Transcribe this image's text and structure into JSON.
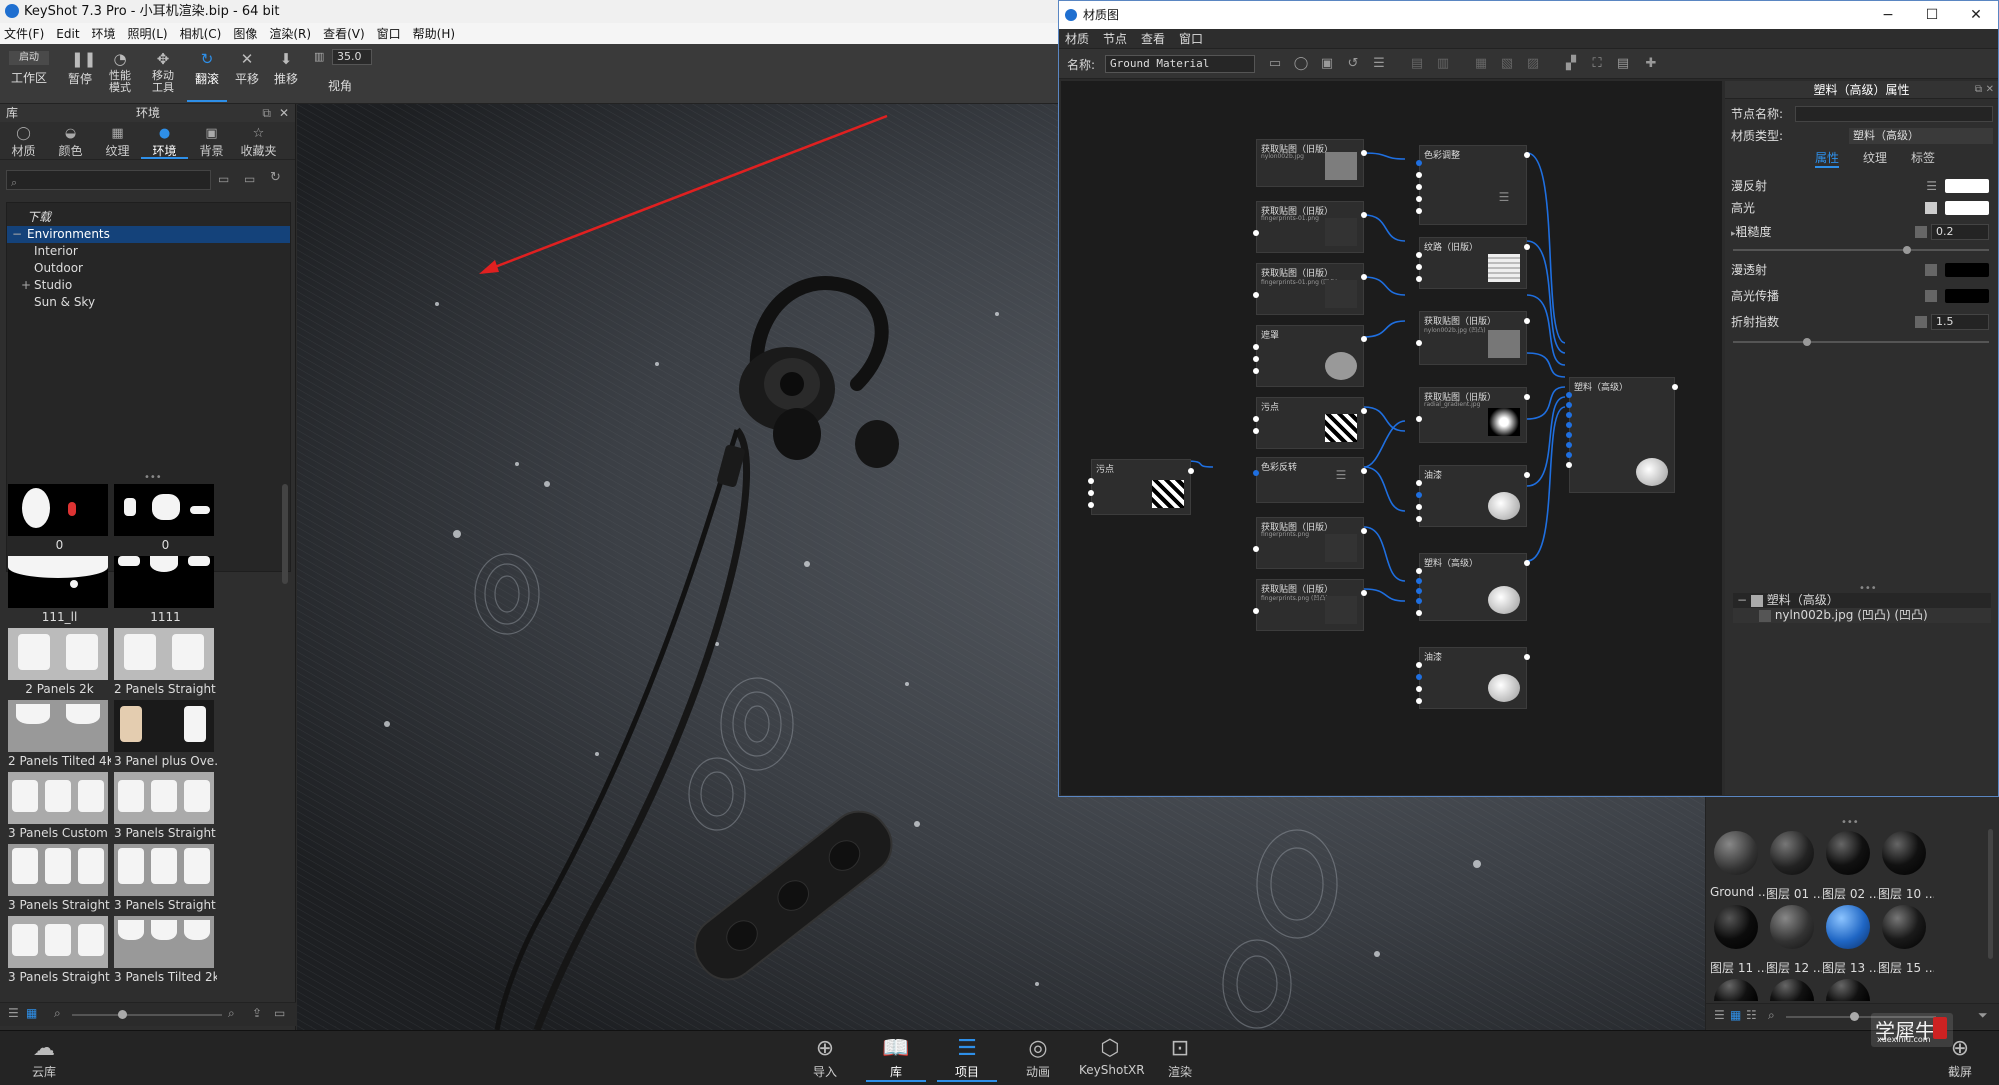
{
  "app": {
    "title": "KeyShot 7.3 Pro - 小耳机渲染.bip - 64 bit",
    "menu": [
      "文件(F)",
      "Edit",
      "环境",
      "照明(L)",
      "相机(C)",
      "图像",
      "渲染(R)",
      "查看(V)",
      "窗口",
      "帮助(H)"
    ]
  },
  "toolbar": {
    "start_label": "启动",
    "workspace_label": "工作区",
    "pause_label": "暂停",
    "perf_label": "性能模式",
    "move_label": "移动工具",
    "tumble_label": "翻滚",
    "pan_label": "平移",
    "dolly_label": "推移",
    "fov_value": "35.0",
    "view_label": "视角"
  },
  "library": {
    "panel_title": "库",
    "section_title": "环境",
    "tabs": [
      "材质",
      "颜色",
      "纹理",
      "环境",
      "背景",
      "收藏夹"
    ],
    "active_tab": "环境",
    "tree": [
      "下载",
      "Environments",
      "Interior",
      "Outdoor",
      "Studio",
      "Sun & Sky"
    ],
    "thumbnails": [
      "0",
      "0",
      "111_ll",
      "1111",
      "2 Panels 2k",
      "2 Panels Straight...",
      "2 Panels Tilted 4K",
      "3 Panel plus Ove...",
      "3 Panels Custom ...",
      "3 Panels Straight...",
      "3 Panels Straight...",
      "3 Panels Straight...",
      "3 Panels Straight...",
      "3 Panels Tilted 2k"
    ]
  },
  "dock": {
    "cloud_label": "云库",
    "items": [
      "导入",
      "库",
      "项目",
      "动画",
      "KeyShotXR",
      "渲染"
    ],
    "screen_label": "截屏"
  },
  "material_graph": {
    "window_title": "材质图",
    "menu": [
      "材质",
      "节点",
      "查看",
      "窗口"
    ],
    "name_label": "名称:",
    "name_value": "Ground Material",
    "nodes": {
      "n1_title": "获取贴图（旧版）",
      "n1_sub": "nylon002b.jpg",
      "n2_title": "获取贴图（旧版）",
      "n2_sub": "fingerprints-01.png",
      "n3_title": "获取贴图（旧版）",
      "n3_sub": "fingerprints-01.png (凹凸)",
      "n4_title": "遮罩",
      "n5_title": "污点",
      "n6_title": "色彩反转",
      "n7_title": "获取贴图（旧版）",
      "n7_sub": "fingerprints.png",
      "n8_title": "获取贴图（旧版）",
      "n8_sub": "fingerprints.png (凹凸)",
      "n9_title": "色彩调整",
      "n10_title": "纹路（旧版）",
      "n11_title": "获取贴图（旧版）",
      "n11_sub": "nylon002b.jpg (凹凸)",
      "n12_title": "获取贴图（旧版）",
      "n12_sub": "radial_gradient.jpg",
      "n13_title": "油漆",
      "n14_title": "塑料（高级）",
      "n15_title": "油漆",
      "n16_title": "塑料（高级）",
      "n17_title": "污点"
    },
    "properties": {
      "header": "塑料（高级）属性",
      "node_name_label": "节点名称:",
      "material_type_label": "材质类型:",
      "material_type_value": "塑料（高级）",
      "tabs": [
        "属性",
        "纹理",
        "标签"
      ],
      "diffuse_label": "漫反射",
      "specular_label": "高光",
      "roughness_label": "粗糙度",
      "roughness_value": "0.2",
      "transmission_label": "漫透射",
      "spec_transmission_label": "高光传播",
      "ior_label": "折射指数",
      "ior_value": "1.5",
      "tree_root": "塑料（高级）",
      "tree_child": "nyln002b.jpg (凹凸) (凹凸)"
    }
  },
  "material_library": {
    "captions": [
      "Ground ...",
      "图层 01 ...",
      "图层 02 ...",
      "图层 10 ...",
      "图层 11 ...",
      "图层 12 ...",
      "图层 13 ...",
      "图层 15 ..."
    ]
  },
  "watermark": {
    "text": "学犀牛",
    "url": "xuexiniu.com"
  },
  "colors": {
    "accent": "#2e8fe8",
    "arrow": "#e02020",
    "wire": "#1f6fe0"
  }
}
